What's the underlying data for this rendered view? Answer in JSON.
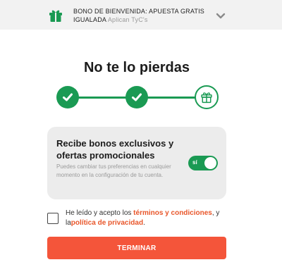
{
  "banner": {
    "text": "BONO DE BIENVENIDA: APUESTA GRATIS IGUALADA",
    "terms": "Aplican TyC's",
    "icon": "gift-icon",
    "expand_icon": "chevron-down-icon"
  },
  "title": "No te lo pierdas",
  "stepper": {
    "steps": [
      {
        "state": "completed",
        "icon": "check-icon"
      },
      {
        "state": "completed",
        "icon": "check-icon"
      },
      {
        "state": "current",
        "icon": "gift-icon"
      }
    ]
  },
  "promo_card": {
    "title": "Recibe bonos exclusivos y ofertas promocionales",
    "description": "Puedes cambiar tus preferencias en cualquier momento en la configuración de tu cuenta.",
    "toggle_label": "sí",
    "toggle_on": true
  },
  "consent": {
    "checked": false,
    "text_1": "He leído y acepto los ",
    "terms_link": "términos y condiciones",
    "text_2": ", y la",
    "privacy_link": "política de privacidad",
    "text_3": "."
  },
  "finish_button": "TERMINAR",
  "colors": {
    "accent_green": "#1a9a53",
    "accent_orange": "#f4553a",
    "banner_bg": "#f2f2f2",
    "card_bg": "#ececec"
  }
}
